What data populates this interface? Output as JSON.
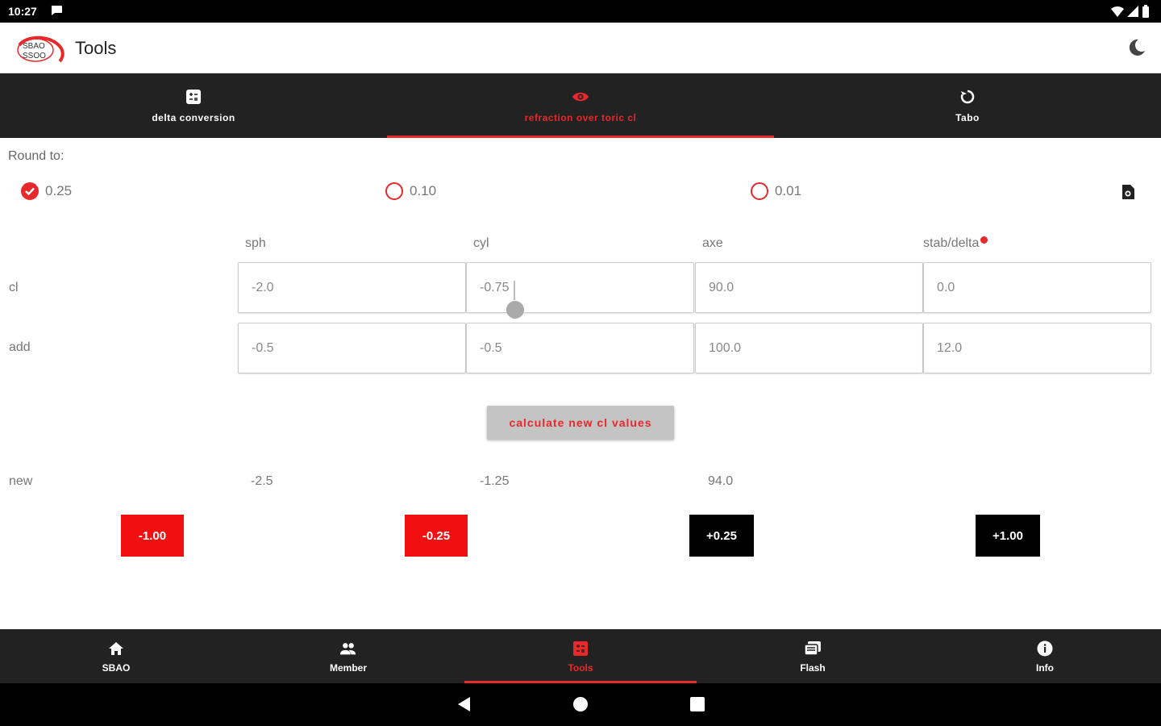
{
  "status_bar": {
    "time": "10:27"
  },
  "app_bar": {
    "title": "Tools",
    "logo_text": "SBAO SSOO"
  },
  "tabs": [
    {
      "label": "delta conversion",
      "icon": "calculator-icon",
      "active": false
    },
    {
      "label": "refraction over toric cl",
      "icon": "eye-icon",
      "active": true
    },
    {
      "label": "Tabo",
      "icon": "rotate-icon",
      "active": false
    }
  ],
  "round": {
    "label": "Round to:",
    "options": [
      {
        "label": "0.25",
        "checked": true
      },
      {
        "label": "0.10",
        "checked": false
      },
      {
        "label": "0.01",
        "checked": false
      }
    ]
  },
  "columns": {
    "sph": "sph",
    "cyl": "cyl",
    "axe": "axe",
    "stab": "stab/delta"
  },
  "rows": {
    "cl": {
      "label": "cl",
      "sph": "-2.0",
      "cyl": "-0.75",
      "axe": "90.0",
      "stab": "0.0"
    },
    "add": {
      "label": "add",
      "sph": "-0.5",
      "cyl": "-0.5",
      "axe": "100.0",
      "stab": "12.0"
    }
  },
  "calculate_label": "calculate new cl values",
  "new_row": {
    "label": "new",
    "sph": "-2.5",
    "cyl": "-1.25",
    "axe": "94.0"
  },
  "steps": [
    "-1.00",
    "-0.25",
    "+0.25",
    "+1.00"
  ],
  "bottom_nav": [
    {
      "label": "SBAO",
      "icon": "home-icon",
      "active": false
    },
    {
      "label": "Member",
      "icon": "people-icon",
      "active": false
    },
    {
      "label": "Tools",
      "icon": "calculator-icon",
      "active": true
    },
    {
      "label": "Flash",
      "icon": "flash-cards-icon",
      "active": false
    },
    {
      "label": "Info",
      "icon": "info-icon",
      "active": false
    }
  ],
  "colors": {
    "accent": "#e8282b",
    "bar": "#222222",
    "step_red": "#f20f0f",
    "step_black": "#000000"
  }
}
